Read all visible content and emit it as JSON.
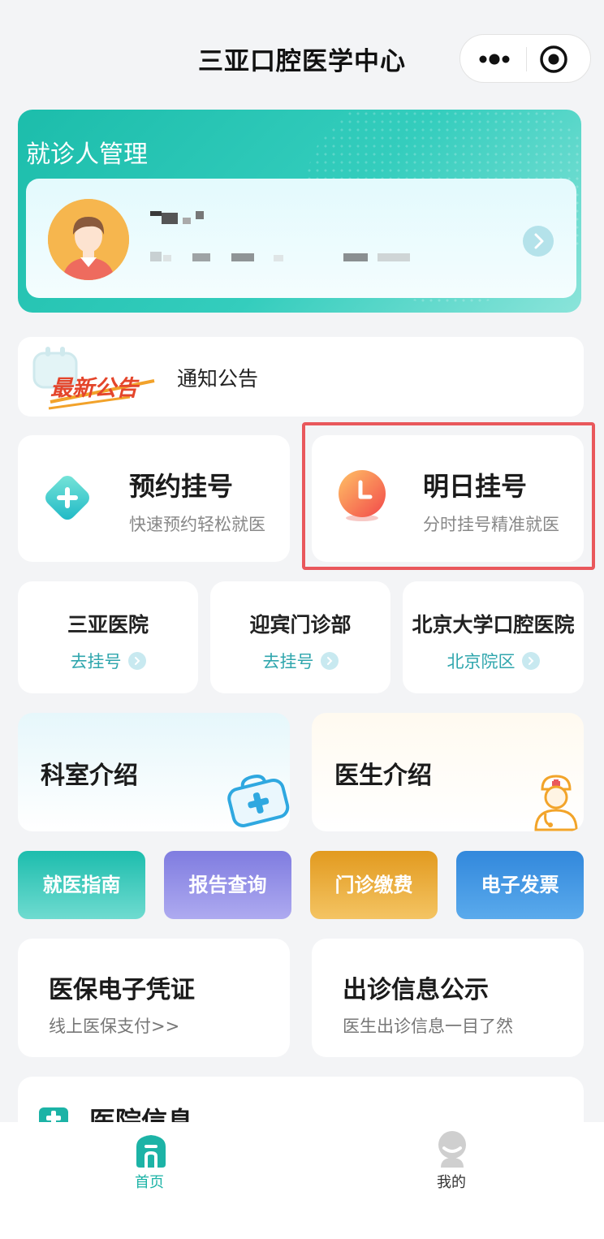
{
  "header": {
    "title": "三亚口腔医学中心"
  },
  "patient": {
    "section_title": "就诊人管理"
  },
  "notice": {
    "badge": "最新公告",
    "text": "通知公告"
  },
  "actions": [
    {
      "title": "预约挂号",
      "subtitle": "快速预约轻松就医"
    },
    {
      "title": "明日挂号",
      "subtitle": "分时挂号精准就医"
    }
  ],
  "hospitals": [
    {
      "name": "三亚医院",
      "link": "去挂号"
    },
    {
      "name": "迎宾门诊部",
      "link": "去挂号"
    },
    {
      "name": "北京大学口腔医院",
      "link": "北京院区"
    }
  ],
  "intro": [
    {
      "title": "科室介绍"
    },
    {
      "title": "医生介绍"
    }
  ],
  "quick_buttons": [
    {
      "label": "就医指南",
      "color": "#2ec4b6"
    },
    {
      "label": "报告查询",
      "color": "#8f8ce6"
    },
    {
      "label": "门诊缴费",
      "color": "#eba62f"
    },
    {
      "label": "电子发票",
      "color": "#3e93e0"
    }
  ],
  "info_cards": [
    {
      "title": "医保电子凭证",
      "subtitle": "线上医保支付>>"
    },
    {
      "title": "出诊信息公示",
      "subtitle": "医生出诊信息一目了然"
    }
  ],
  "hospital_info": {
    "title": "医院信息"
  },
  "tabbar": {
    "home": "首页",
    "mine": "我的",
    "active_color": "#1cb3a6"
  }
}
